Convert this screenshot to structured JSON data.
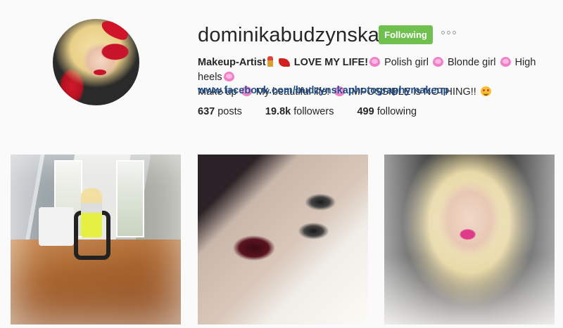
{
  "profile": {
    "username": "dominikabudzynska",
    "follow_label": "Following",
    "bio": {
      "line1_bold": "Makeup-Artist",
      "line1_bold2": "LOVE MY LIFE!",
      "polish": "Polish girl",
      "blonde": "Blonde girl",
      "heels": "High heels",
      "makeup": "Make up",
      "beautiful": "My beautiful life!",
      "impossible": "IMPOSSIBLE is NOTHING!!"
    },
    "link": "www.facebook.com/budzynskaphotographymakeup",
    "stats": {
      "posts_count": "637",
      "posts_label": "posts",
      "followers_count": "19.8k",
      "followers_label": "followers",
      "following_count": "499",
      "following_label": "following"
    }
  },
  "icons": {
    "more": "ellipsis-icon",
    "emoji": [
      "lipstick-icon",
      "high-heel-icon",
      "pink-heart-icon",
      "heart-eyes-icon"
    ]
  },
  "colors": {
    "follow_button": "#70c050",
    "link": "#1f4e8a",
    "heart": "#f07fc8"
  }
}
